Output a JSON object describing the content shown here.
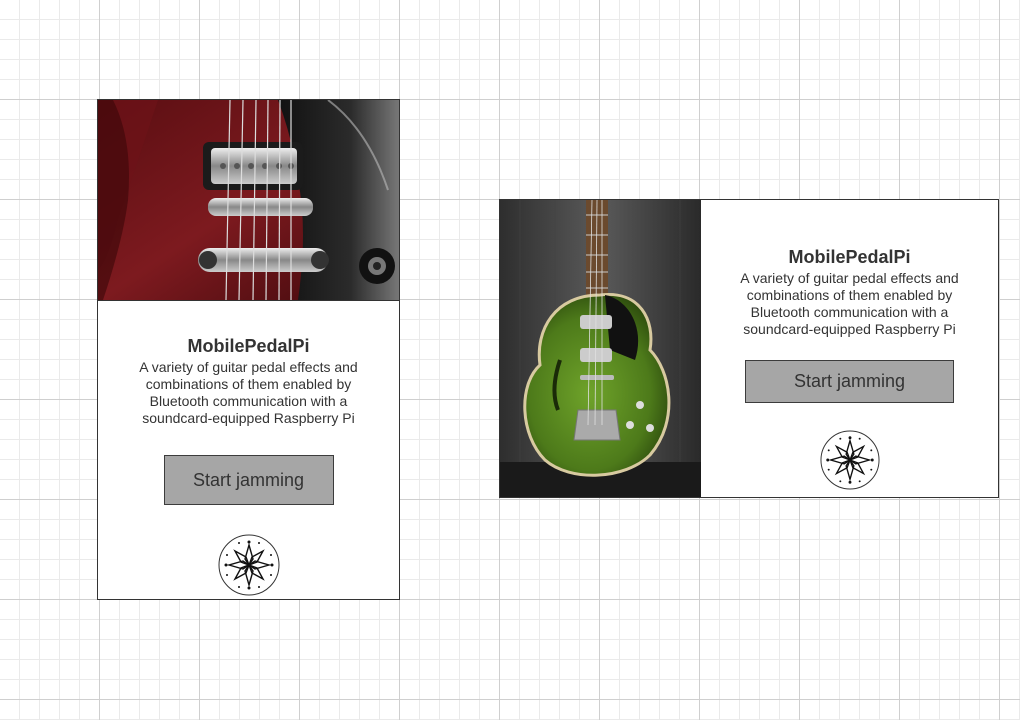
{
  "cards": [
    {
      "title": "MobilePedalPi",
      "description": "A variety of guitar pedal effects and combinations of them enabled by Bluetooth communication with a soundcard-equipped Raspberry Pi",
      "button_label": "Start jamming",
      "image": "red-electric-guitar-closeup-photo",
      "logo": "star-ornament-logo-icon"
    },
    {
      "title": "MobilePedalPi",
      "description": "A variety of guitar pedal effects and combinations of them enabled by Bluetooth communication with a soundcard-equipped Raspberry Pi",
      "button_label": "Start jamming",
      "image": "green-hollow-body-guitar-photo",
      "logo": "star-ornament-logo-icon"
    }
  ],
  "colors": {
    "button_bg": "#a6a6a6",
    "card_border": "#333333",
    "text": "#333333",
    "grid_major": "#cfcfcf",
    "grid_minor": "#eaeaea"
  }
}
